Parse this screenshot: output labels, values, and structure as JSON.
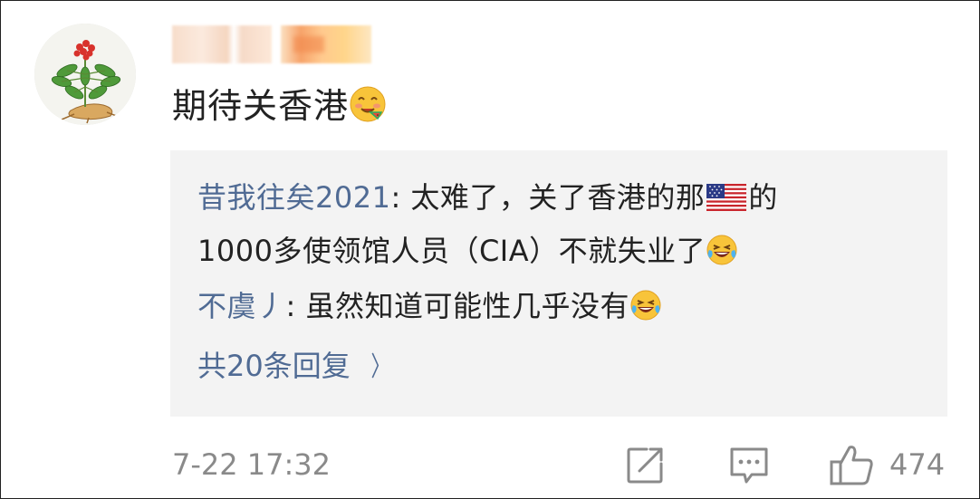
{
  "post": {
    "comment_text": "期待关香港",
    "timestamp": "7-22 17:32",
    "like_count": "474"
  },
  "replies": [
    {
      "user": "昔我往矣2021",
      "text_line1_before_flag": ": 太难了，关了香港的那",
      "text_line1_after_flag": "的",
      "text_line2": "1000多使领馆人员（CIA）不就失业了"
    },
    {
      "user": "不虞丿",
      "text": ": 虽然知道可能性几乎没有"
    }
  ],
  "more_replies": {
    "label": "共20条回复",
    "chevron": "〉"
  },
  "icons": {
    "avatar": "ginseng-plant-avatar",
    "comment_emoji": "yum-face-emoji",
    "reply_emoji": "laughing-tears-emoji",
    "flag": "us-flag-emoji",
    "share": "share-icon",
    "comment": "comment-icon",
    "like": "thumbs-up-icon"
  },
  "colors": {
    "username_blue": "#506b94",
    "meta_gray": "#8a8a8a",
    "reply_bg": "#f3f3f3"
  }
}
